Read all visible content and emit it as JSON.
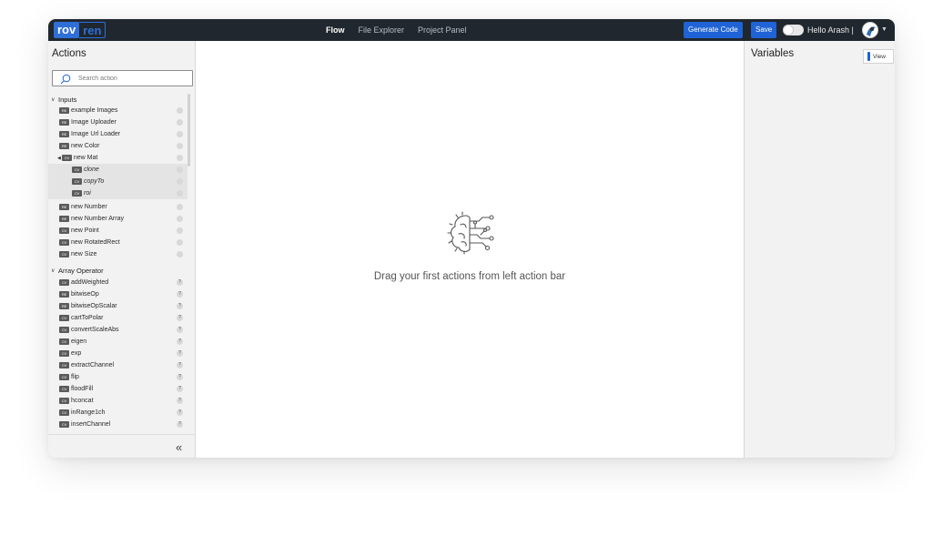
{
  "navbar": {
    "logo_part1": "rov",
    "logo_part2": "ren",
    "links": [
      {
        "label": "Flow",
        "active": true
      },
      {
        "label": "File Explorer",
        "active": false
      },
      {
        "label": "Project Panel",
        "active": false
      }
    ],
    "generate_label": "Generate Code",
    "save_label": "Save",
    "dark_mode_on": false,
    "greeting": "Hello Arash |"
  },
  "sidebar": {
    "title": "Actions",
    "search_placeholder": "Search action",
    "collapse_icon": "double-chevron-left",
    "groups": [
      {
        "label": "Inputs",
        "items": [
          {
            "badge": "RE",
            "label": "example Images",
            "marker": "dot"
          },
          {
            "badge": "RE",
            "label": "Image Uploader",
            "marker": "dot"
          },
          {
            "badge": "RE",
            "label": "Image Url Loader",
            "marker": "dot"
          },
          {
            "badge": "RE",
            "label": "new Color",
            "marker": "dot"
          },
          {
            "badge": "CV",
            "label": "new Mat",
            "marker": "dot",
            "expanded": true
          },
          {
            "badge": "CV",
            "label": "clone",
            "marker": "dot",
            "sub": true
          },
          {
            "badge": "CV",
            "label": "copyTo",
            "marker": "dot",
            "sub": true
          },
          {
            "badge": "CV",
            "label": "roi",
            "marker": "dot",
            "sub": true
          },
          {
            "badge": "RE",
            "label": "new Number",
            "marker": "dot"
          },
          {
            "badge": "RE",
            "label": "new Number Array",
            "marker": "dot"
          },
          {
            "badge": "CV",
            "label": "new Point",
            "marker": "dot"
          },
          {
            "badge": "CV",
            "label": "new RotatedRect",
            "marker": "dot"
          },
          {
            "badge": "CV",
            "label": "new Size",
            "marker": "dot"
          }
        ]
      },
      {
        "label": "Array Operator",
        "items": [
          {
            "badge": "CV",
            "label": "addWeighted",
            "marker": "?"
          },
          {
            "badge": "RE",
            "label": "bitwiseOp",
            "marker": "?"
          },
          {
            "badge": "RE",
            "label": "bitwiseOpScalar",
            "marker": "?"
          },
          {
            "badge": "CV",
            "label": "cartToPolar",
            "marker": "?"
          },
          {
            "badge": "CV",
            "label": "convertScaleAbs",
            "marker": "?"
          },
          {
            "badge": "CV",
            "label": "eigen",
            "marker": "?"
          },
          {
            "badge": "CV",
            "label": "exp",
            "marker": "?"
          },
          {
            "badge": "CV",
            "label": "extractChannel",
            "marker": "?"
          },
          {
            "badge": "CV",
            "label": "flip",
            "marker": "?"
          },
          {
            "badge": "CV",
            "label": "floodFill",
            "marker": "?"
          },
          {
            "badge": "CV",
            "label": "hconcat",
            "marker": "?"
          },
          {
            "badge": "CV",
            "label": "inRange1ch",
            "marker": "?"
          },
          {
            "badge": "CV",
            "label": "insertChannel",
            "marker": "?"
          }
        ]
      }
    ]
  },
  "canvas": {
    "empty_icon": "ai-brain-circuit-icon",
    "empty_message": "Drag your first actions from left action bar"
  },
  "variables": {
    "title": "Variables",
    "view_label": "View"
  },
  "colors": {
    "navbar_bg": "#20272e",
    "accent": "#1f63d6",
    "panel_bg": "#f2f2f2"
  }
}
